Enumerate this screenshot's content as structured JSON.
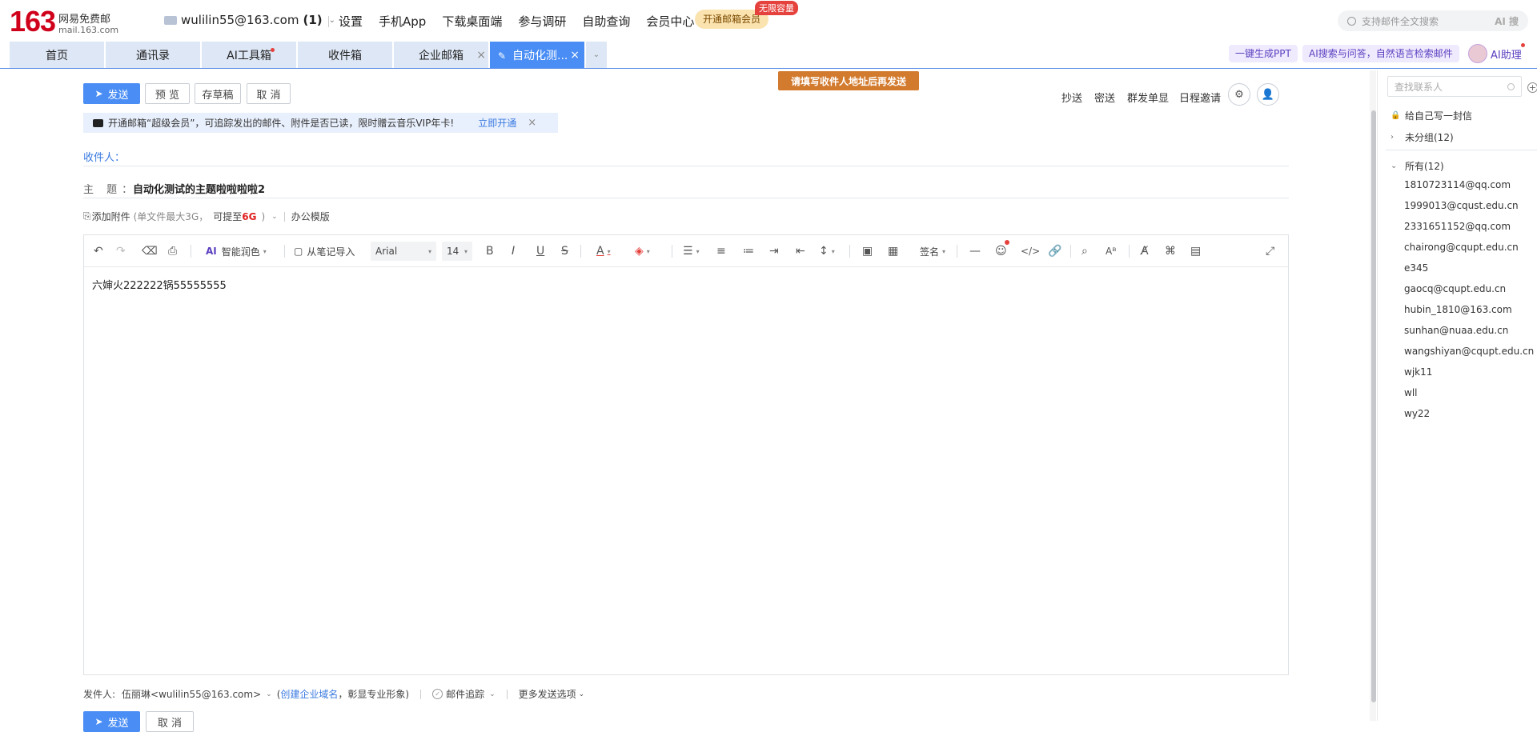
{
  "header": {
    "logo_num": "163",
    "logo_name": "网易免费邮",
    "logo_sub": "mail.163.com",
    "account": "wulilin55@163.com",
    "account_count": "(1)",
    "nav": [
      "设置",
      "手机App",
      "下载桌面端",
      "参与调研",
      "自助查询",
      "会员中心"
    ],
    "vip_button": "开通邮箱会员",
    "vip_badge": "无限容量",
    "search_placeholder": "支持邮件全文搜索",
    "search_ai": "AI 搜"
  },
  "tabs": {
    "items": [
      "首页",
      "通讯录",
      "AI工具箱",
      "收件箱",
      "企业邮箱"
    ],
    "active": "自动化测...",
    "ai_ppt": "一键生成PPT",
    "ai_search": "AI搜索与问答，自然语言检索邮件",
    "ai_assist": "AI助理"
  },
  "compose": {
    "send": "发送",
    "preview": "预 览",
    "draft": "存草稿",
    "cancel": "取 消",
    "warning": "请填写收件人地址后再发送",
    "cc": "抄送",
    "bcc": "密送",
    "single": "群发单显",
    "schedule": "日程邀请",
    "promo_text": "开通邮箱“超级会员”，可追踪发出的邮件、附件是否已读，限时赠云音乐VIP年卡!",
    "promo_link": "立即开通",
    "to_label": "收件人：",
    "subject_label": "主 题：",
    "subject_value": "自动化测试的主题啦啦啦啦2",
    "attach_label": "添加附件",
    "attach_hint": "(单文件最大3G，",
    "attach_up": "可提至",
    "attach_size": "6G",
    "attach_close": ")",
    "template": "办公模版"
  },
  "toolbar": {
    "polish": "智能润色",
    "import": "从笔记导入",
    "font": "Arial",
    "size": "14",
    "signature": "签名"
  },
  "editor": {
    "body": "六婶火222222锅55555555"
  },
  "footer": {
    "sender_label": "发件人:",
    "sender_value": "伍丽琳<wulilin55@163.com>",
    "domain_link": "创建企业域名",
    "domain_hint": "，彰显专业形象)",
    "tracking": "邮件追踪",
    "more": "更多发送选项",
    "send": "发送",
    "cancel": "取 消"
  },
  "sidebar": {
    "search_placeholder": "查找联系人",
    "self_letter": "给自己写一封信",
    "ungrouped": "未分组(12)",
    "all": "所有(12)",
    "contacts": [
      "1810723114@qq.com",
      "1999013@cqust.edu.cn",
      "2331651152@qq.com",
      "chairong@cqupt.edu.cn",
      "e345",
      "gaocq@cqupt.edu.cn",
      "hubin_1810@163.com",
      "sunhan@nuaa.edu.cn",
      "wangshiyan@cqupt.edu.cn",
      "wjk11",
      "wll",
      "wy22"
    ]
  },
  "colors": {
    "accent": "#4a8ef5",
    "brand_red": "#d0021b",
    "warning": "#d27a2e"
  }
}
